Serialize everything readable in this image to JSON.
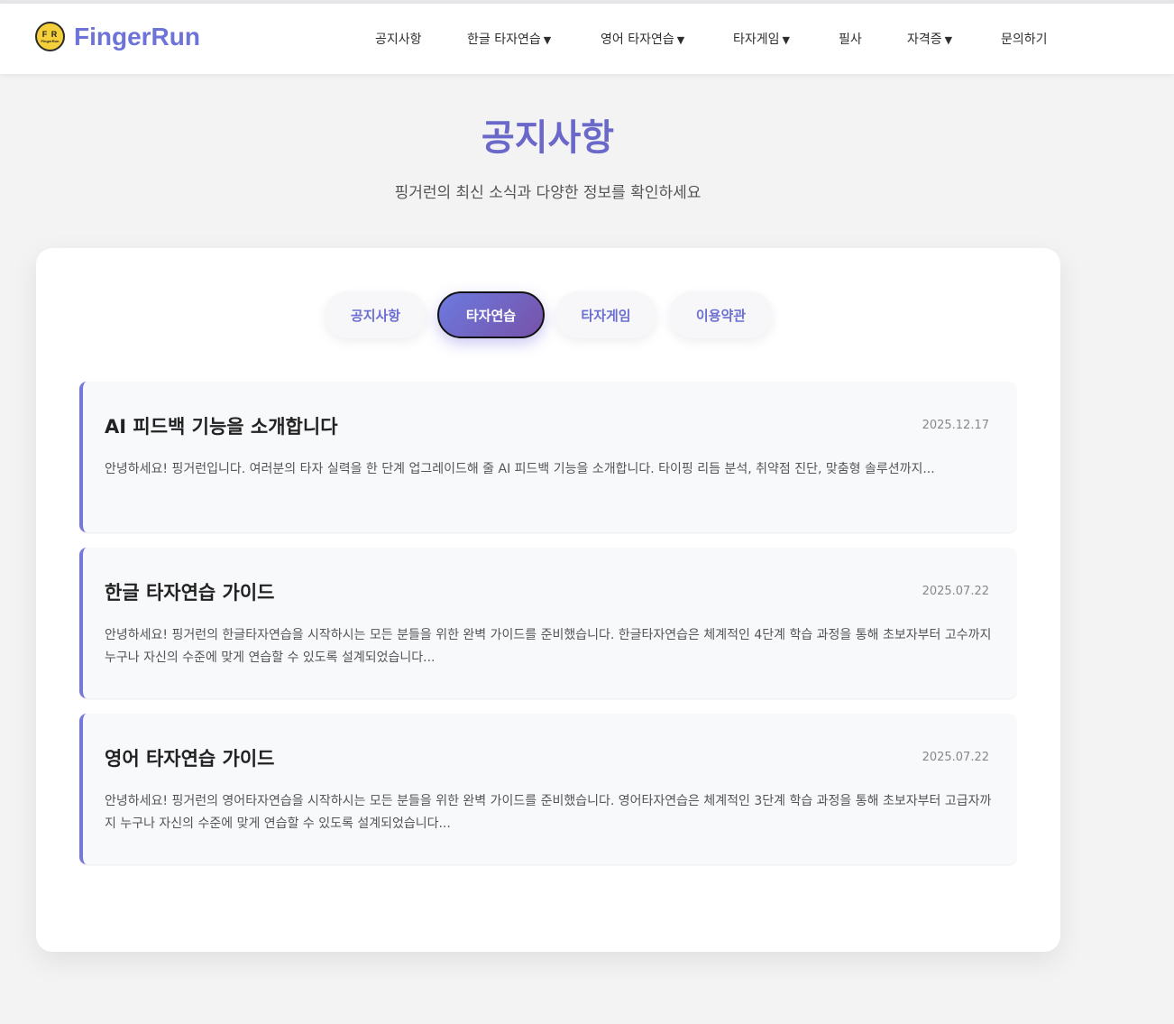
{
  "header": {
    "logo_badge": "F R",
    "logo_badge_small": "FingerRun",
    "logo_text": "FingerRun",
    "nav": [
      {
        "label": "공지사항",
        "dropdown": ""
      },
      {
        "label": "한글 타자연습",
        "dropdown": "▼"
      },
      {
        "label": "영어 타자연습",
        "dropdown": "▼"
      },
      {
        "label": "타자게임",
        "dropdown": "▼"
      },
      {
        "label": "필사",
        "dropdown": ""
      },
      {
        "label": "자격증",
        "dropdown": "▼"
      },
      {
        "label": "문의하기",
        "dropdown": ""
      }
    ]
  },
  "page": {
    "title": "공지사항",
    "subtitle": "핑거런의 최신 소식과 다양한 정보를 확인하세요"
  },
  "tabs": [
    {
      "label": "공지사항",
      "active": false
    },
    {
      "label": "타자연습",
      "active": true
    },
    {
      "label": "타자게임",
      "active": false
    },
    {
      "label": "이용약관",
      "active": false
    }
  ],
  "posts": [
    {
      "title": "AI 피드백 기능을 소개합니다",
      "date": "2025.12.17",
      "excerpt": "안녕하세요! 핑거런입니다. 여러분의 타자 실력을 한 단계 업그레이드해 줄 AI 피드백 기능을 소개합니다. 타이핑 리듬 분석, 취약점 진단, 맞춤형 솔루션까지..."
    },
    {
      "title": "한글 타자연습 가이드",
      "date": "2025.07.22",
      "excerpt": "안녕하세요! 핑거런의 한글타자연습을 시작하시는 모든 분들을 위한 완벽 가이드를 준비했습니다. 한글타자연습은 체계적인 4단계 학습 과정을 통해 초보자부터 고수까지 누구나 자신의 수준에 맞게 연습할 수 있도록 설계되었습니다..."
    },
    {
      "title": "영어 타자연습 가이드",
      "date": "2025.07.22",
      "excerpt": "안녕하세요! 핑거런의 영어타자연습을 시작하시는 모든 분들을 위한 완벽 가이드를 준비했습니다. 영어타자연습은 체계적인 3단계 학습 과정을 통해 초보자부터 고급자까지 누구나 자신의 수준에 맞게 연습할 수 있도록 설계되었습니다..."
    }
  ],
  "colors": {
    "brand": "#6e73d8",
    "title": "#6a68c9",
    "accent_border": "#7679d8",
    "active_tab_gradient": [
      "#6c7ae0",
      "#7752a8"
    ],
    "logo_badge": "#f5cf3a"
  }
}
